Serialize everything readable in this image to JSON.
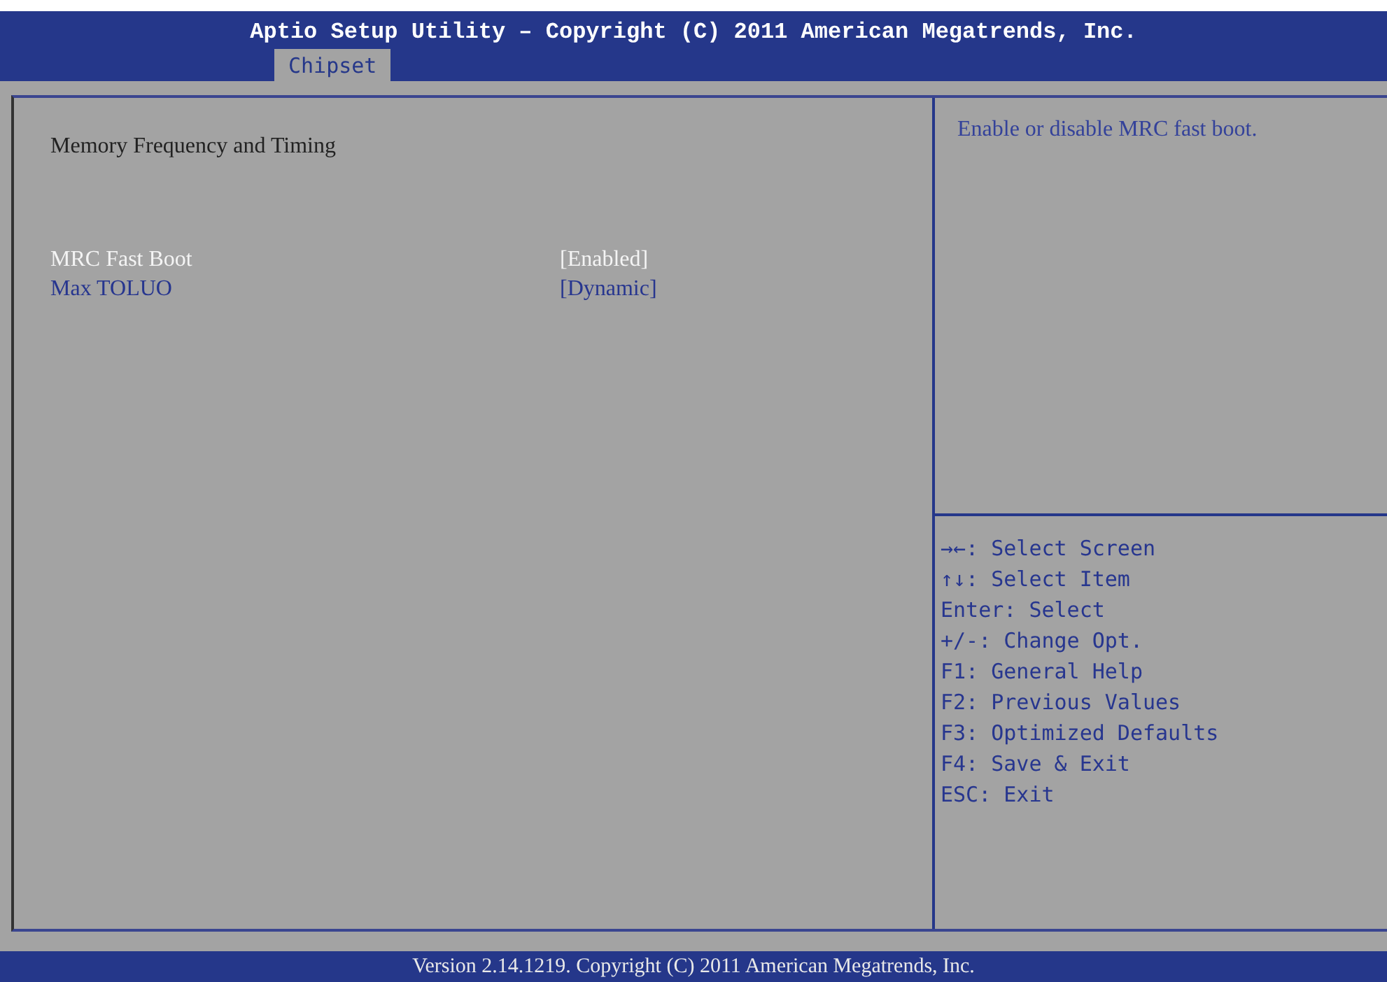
{
  "header": {
    "title": "Aptio Setup Utility – Copyright (C) 2011 American Megatrends, Inc.",
    "tabs": [
      {
        "label": "Chipset",
        "selected": true
      }
    ]
  },
  "settings": [
    {
      "kind": "heading",
      "label": "Memory Frequency and Timing"
    },
    {
      "kind": "option",
      "label": "MRC Fast Boot",
      "value": "[Enabled]",
      "selected": true
    },
    {
      "kind": "option",
      "label": "Max TOLUO",
      "value": "[Dynamic]",
      "selected": false
    }
  ],
  "help_text": "Enable or disable MRC fast boot.",
  "key_help": [
    "→←: Select Screen",
    "↑↓: Select Item",
    "Enter: Select",
    "+/-: Change Opt.",
    "F1: General Help",
    "F2: Previous Values",
    "F3: Optimized Defaults",
    "F4: Save & Exit",
    "ESC: Exit"
  ],
  "status_bar": "Version 2.14.1219. Copyright (C) 2011 American Megatrends, Inc."
}
